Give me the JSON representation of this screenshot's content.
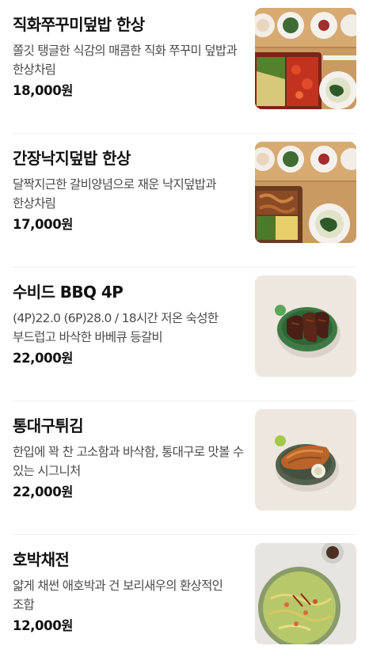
{
  "menu_items": [
    {
      "name": "직화쭈꾸미덮밥 한상",
      "description": "쫄깃 탱글한 식감의 매콤한 직화 쭈꾸미 덮밥과 한상차림",
      "price": "18,000원",
      "image_icon": "jjukkumi-set-meal-photo"
    },
    {
      "name": "간장낙지덮밥 한상",
      "description": "달짝지근한 갈비양념으로 재운 낙지덮밥과 한상차림",
      "price": "17,000원",
      "image_icon": "nakji-set-meal-photo"
    },
    {
      "name": "수비드 BBQ 4P",
      "description": "(4P)22.0 (6P)28.0 / 18시간 저온 숙성한 부드럽고 바삭한 바베큐 등갈비",
      "price": "22,000원",
      "image_icon": "bbq-ribs-photo"
    },
    {
      "name": "통대구튀김",
      "description": "한입에 꽉 찬 고소함과 바삭함, 통대구로 맛볼 수 있는 시그니처",
      "price": "22,000원",
      "image_icon": "fried-cod-photo"
    },
    {
      "name": "호박채전",
      "description": "얇게 채썬 애호박과 건 보리새우의 환상적인 조합",
      "price": "12,000원",
      "image_icon": "zucchini-pancake-photo"
    }
  ],
  "colors": {
    "text_primary": "#111111",
    "text_secondary": "#4a4a4a",
    "divider": "#efefef",
    "thumb_beige": "#eee7e0"
  }
}
